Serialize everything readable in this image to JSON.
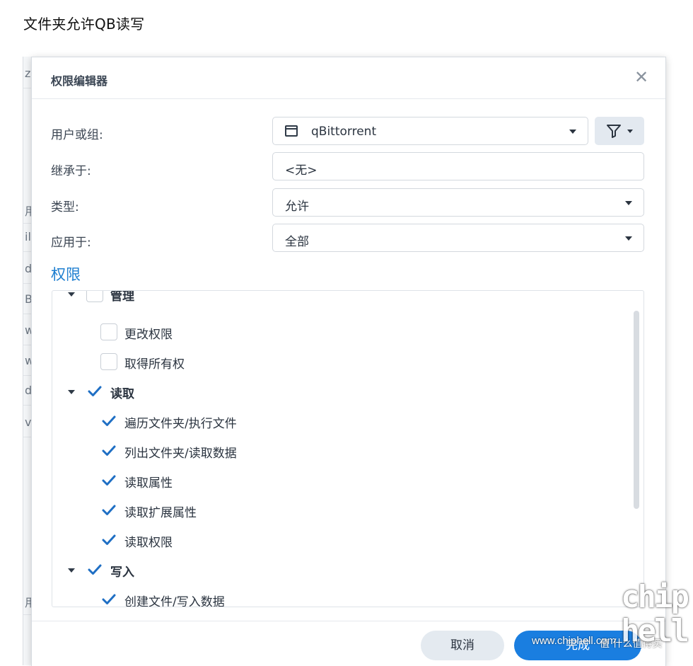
{
  "post_title": "文件夹允许QB读写",
  "background_window": {
    "fragments": [
      "z",
      "用",
      "il",
      "d",
      "B",
      "w",
      "w",
      "d",
      "v",
      "用"
    ]
  },
  "dialog": {
    "title": "权限编辑器",
    "close_glyph": "✕",
    "form": {
      "user_or_group": {
        "label": "用户或组:",
        "value": "qBittorrent"
      },
      "inherit_from": {
        "label": "继承于:",
        "value": "<无>"
      },
      "type": {
        "label": "类型:",
        "value": "允许"
      },
      "apply_to": {
        "label": "应用于:",
        "value": "全部"
      }
    },
    "permissions_title": "权限",
    "tree": [
      {
        "label": "管理",
        "level": 0,
        "checked": false,
        "group": true
      },
      {
        "label": "更改权限",
        "level": 1,
        "checked": false,
        "group": false
      },
      {
        "label": "取得所有权",
        "level": 1,
        "checked": false,
        "group": false
      },
      {
        "label": "读取",
        "level": 0,
        "checked": true,
        "group": true
      },
      {
        "label": "遍历文件夹/执行文件",
        "level": 1,
        "checked": true,
        "group": false
      },
      {
        "label": "列出文件夹/读取数据",
        "level": 1,
        "checked": true,
        "group": false
      },
      {
        "label": "读取属性",
        "level": 1,
        "checked": true,
        "group": false
      },
      {
        "label": "读取扩展属性",
        "level": 1,
        "checked": true,
        "group": false
      },
      {
        "label": "读取权限",
        "level": 1,
        "checked": true,
        "group": false
      },
      {
        "label": "写入",
        "level": 0,
        "checked": true,
        "group": true
      },
      {
        "label": "创建文件/写入数据",
        "level": 1,
        "checked": true,
        "group": false
      }
    ],
    "buttons": {
      "cancel": "取消",
      "done": "完成"
    }
  },
  "watermark": {
    "url": "www.chiphell.com",
    "logo_line1": "chip",
    "logo_line2": "hell",
    "badge": "值 什么值得买"
  },
  "colors": {
    "accent": "#1a7ee0",
    "check": "#1f6fc4",
    "section_title": "#1f7fd0"
  },
  "icons": {
    "check": "check-icon",
    "close": "close-icon",
    "filter": "filter-icon",
    "window": "window-icon",
    "expand": "triangle-down-icon"
  }
}
